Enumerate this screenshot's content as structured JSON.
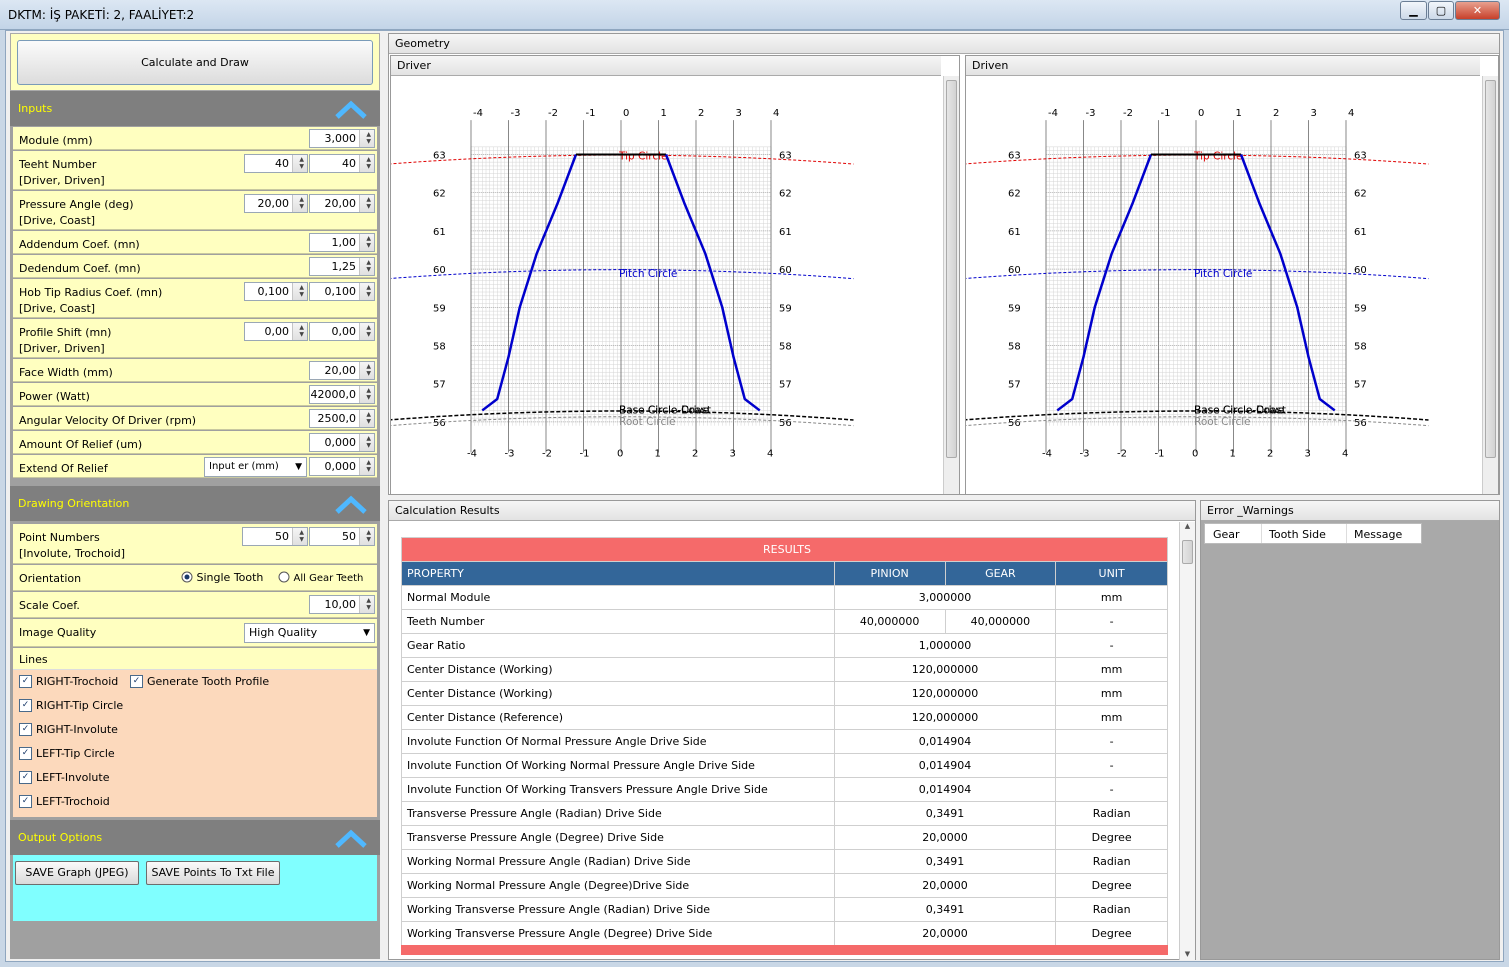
{
  "window": {
    "title": "DKTM: İŞ PAKETİ: 2,  FAALİYET:2",
    "minimize": "▁",
    "maximize": "▢",
    "close": "✕"
  },
  "left": {
    "calc_button": "Calculate and Draw",
    "inputs_title": "Inputs",
    "inputs": [
      {
        "label": "Module (mm)",
        "values": [
          "3,000"
        ]
      },
      {
        "label": "Teeht Number",
        "label2": "[Driver, Driven]",
        "values": [
          "40",
          "40"
        ]
      },
      {
        "label": "Pressure Angle (deg)",
        "label2": "[Drive, Coast]",
        "values": [
          "20,00",
          "20,00"
        ]
      },
      {
        "label": "Addendum Coef. (mn)",
        "values": [
          "1,00"
        ]
      },
      {
        "label": "Dedendum Coef. (mn)",
        "values": [
          "1,25"
        ]
      },
      {
        "label": "Hob Tip Radius Coef. (mn)",
        "label2": "[Drive, Coast]",
        "values": [
          "0,100",
          "0,100"
        ]
      },
      {
        "label": "Profile Shift (mn)",
        "label2": "[Driver, Driven]",
        "values": [
          "0,00",
          "0,00"
        ]
      },
      {
        "label": "Face Width (mm)",
        "values": [
          "20,00"
        ]
      },
      {
        "label": "Power (Watt)",
        "values": [
          "42000,0"
        ]
      },
      {
        "label": "Angular Velocity Of Driver (rpm)",
        "values": [
          "2500,0"
        ]
      },
      {
        "label": "Amount Of Relief (um)",
        "values": [
          "0,000"
        ]
      },
      {
        "label": "Extend Of Relief",
        "dropdown": "Input er (mm)",
        "values": [
          "0,000"
        ]
      }
    ],
    "drawing_title": "Drawing Orientation",
    "point_numbers": {
      "label": "Point Numbers",
      "label2": "[Involute, Trochoid]",
      "values": [
        "50",
        "50"
      ]
    },
    "orientation": {
      "label": "Orientation",
      "opt1": "Single Tooth",
      "opt2": "All Gear Teeth"
    },
    "scale": {
      "label": "Scale Coef.",
      "value": "10,00"
    },
    "quality": {
      "label": "Image Quality",
      "value": "High Quality"
    },
    "lines": {
      "title": "Lines",
      "items": [
        "RIGHT-Trochoid",
        "Generate Tooth Profile",
        "RIGHT-Tip Circle",
        "RIGHT-Involute",
        "LEFT-Tip Circle",
        "LEFT-Involute",
        "LEFT-Trochoid"
      ]
    },
    "output_title": "Output Options",
    "save_graph": "SAVE Graph (JPEG)",
    "save_points": "SAVE Points To Txt File"
  },
  "geometry": {
    "title": "Geometry",
    "driver": "Driver",
    "driven": "Driven",
    "xticks": [
      "-4",
      "-3",
      "-2",
      "-1",
      "0",
      "1",
      "2",
      "3",
      "4"
    ],
    "yticks": [
      "63",
      "62",
      "61",
      "60",
      "59",
      "58",
      "57",
      "56"
    ],
    "tip": "Tip Circle",
    "pitch": "Pitch Circle",
    "base": "Base Circle-Coast",
    "base2": "Base Circle-Drive",
    "root": "Root Circle",
    "colors": {
      "tip": "#e00000",
      "pitch": "#0000cc",
      "profile": "#0000cc",
      "base": "#000000"
    }
  },
  "results": {
    "panel_title": "Calculation Results",
    "banner": "RESULTS",
    "headers": [
      "PROPERTY",
      "PINION",
      "GEAR",
      "UNIT"
    ],
    "rows": [
      {
        "p": "Normal Module",
        "v": "3,000000",
        "u": "mm"
      },
      {
        "p": "Teeth Number",
        "a": "40,000000",
        "b": "40,000000",
        "u": "-"
      },
      {
        "p": "Gear Ratio",
        "v": "1,000000",
        "u": "-"
      },
      {
        "p": "Center Distance (Working)",
        "v": "120,000000",
        "u": "mm"
      },
      {
        "p": "Center Distance (Working)",
        "v": "120,000000",
        "u": "mm"
      },
      {
        "p": "Center Distance (Reference)",
        "v": "120,000000",
        "u": "mm"
      },
      {
        "p": "Involute Function Of Normal Pressure Angle Drive Side",
        "v": "0,014904",
        "u": "-"
      },
      {
        "p": "Involute Function Of Working Normal Pressure Angle Drive Side",
        "v": "0,014904",
        "u": "-"
      },
      {
        "p": "Involute Function Of Working Transvers Pressure Angle Drive Side",
        "v": "0,014904",
        "u": "-"
      },
      {
        "p": "Transverse Pressure Angle (Radian) Drive Side",
        "v": "0,3491",
        "u": "Radian"
      },
      {
        "p": "Transverse Pressure Angle (Degree) Drive Side",
        "v": "20,0000",
        "u": "Degree"
      },
      {
        "p": "Working Normal Pressure Angle (Radian) Drive Side",
        "v": "0,3491",
        "u": "Radian"
      },
      {
        "p": "Working Normal Pressure Angle (Degree)Drive Side",
        "v": "20,0000",
        "u": "Degree"
      },
      {
        "p": "Working Transverse Pressure Angle (Radian) Drive Side",
        "v": "0,3491",
        "u": "Radian"
      },
      {
        "p": "Working Transverse Pressure Angle (Degree) Drive Side",
        "v": "20,0000",
        "u": "Degree"
      }
    ]
  },
  "errors": {
    "title": "Error _Warnings",
    "headers": [
      "Gear",
      "Tooth Side",
      "Message"
    ]
  }
}
